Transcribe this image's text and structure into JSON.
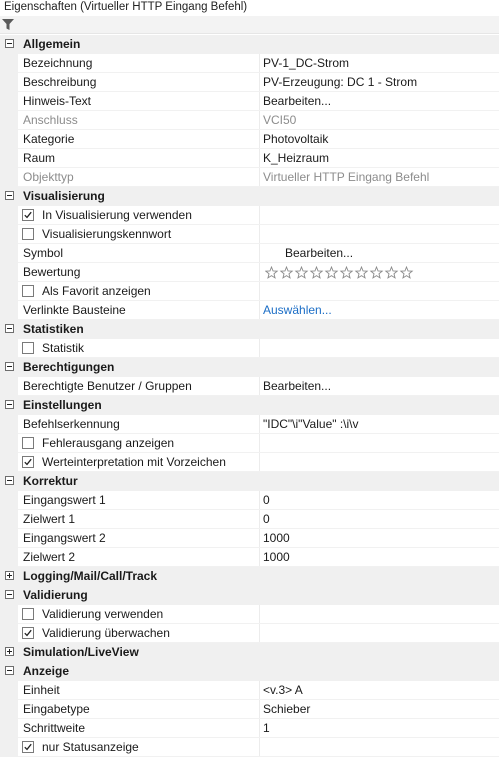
{
  "window": {
    "title": "Eigenschaften (Virtueller HTTP Eingang Befehl)"
  },
  "toolbar": {
    "filter_icon": "filter-icon"
  },
  "colors": {
    "link": "#1c6ec6",
    "disabled": "#8c8c8c",
    "category_bg": "#f0f0f0"
  },
  "sections": {
    "allgemein": {
      "label": "Allgemein",
      "bezeichnung": {
        "label": "Bezeichnung",
        "value": "PV-1_DC-Strom"
      },
      "beschreibung": {
        "label": "Beschreibung",
        "value": "PV-Erzeugung: DC 1 - Strom"
      },
      "hinweis": {
        "label": "Hinweis-Text",
        "value": "Bearbeiten..."
      },
      "anschluss": {
        "label": "Anschluss",
        "value": "VCI50"
      },
      "kategorie": {
        "label": "Kategorie",
        "value": "Photovoltaik"
      },
      "raum": {
        "label": "Raum",
        "value": "K_Heizraum"
      },
      "objekttyp": {
        "label": "Objekttyp",
        "value": "Virtueller HTTP Eingang Befehl"
      }
    },
    "visualisierung": {
      "label": "Visualisierung",
      "in_visu": {
        "label": "In Visualisierung verwenden",
        "checked": true
      },
      "kennwort": {
        "label": "Visualisierungskennwort",
        "checked": false
      },
      "symbol": {
        "label": "Symbol",
        "value": "Bearbeiten..."
      },
      "bewertung": {
        "label": "Bewertung",
        "stars_total": 10,
        "stars_filled": 0
      },
      "favorit": {
        "label": "Als Favorit anzeigen",
        "checked": false
      },
      "bausteine": {
        "label": "Verlinkte Bausteine",
        "value": "Auswählen..."
      }
    },
    "statistiken": {
      "label": "Statistiken",
      "statistik": {
        "label": "Statistik",
        "checked": false
      }
    },
    "berechtigungen": {
      "label": "Berechtigungen",
      "benutzer": {
        "label": "Berechtigte Benutzer / Gruppen",
        "value": "Bearbeiten..."
      }
    },
    "einstellungen": {
      "label": "Einstellungen",
      "befehl": {
        "label": "Befehlserkennung",
        "value": "\"IDC\"\\i\"Value\" :\\i\\v"
      },
      "fehler": {
        "label": "Fehlerausgang anzeigen",
        "checked": false
      },
      "vorzeichen": {
        "label": "Werteinterpretation mit Vorzeichen",
        "checked": true
      }
    },
    "korrektur": {
      "label": "Korrektur",
      "eingang1": {
        "label": "Eingangswert 1",
        "value": "0"
      },
      "ziel1": {
        "label": "Zielwert 1",
        "value": "0"
      },
      "eingang2": {
        "label": "Eingangswert 2",
        "value": "1000"
      },
      "ziel2": {
        "label": "Zielwert 2",
        "value": "1000"
      }
    },
    "logging": {
      "label": "Logging/Mail/Call/Track"
    },
    "validierung": {
      "label": "Validierung",
      "verwenden": {
        "label": "Validierung verwenden",
        "checked": false
      },
      "ueberwachen": {
        "label": "Validierung überwachen",
        "checked": true
      }
    },
    "simulation": {
      "label": "Simulation/LiveView"
    },
    "anzeige": {
      "label": "Anzeige",
      "einheit": {
        "label": "Einheit",
        "value": "<v.3> A"
      },
      "eingabetyp": {
        "label": "Eingabetype",
        "value": "Schieber"
      },
      "schrittweite": {
        "label": "Schrittweite",
        "value": "1"
      },
      "status": {
        "label": "nur Statusanzeige",
        "checked": true
      }
    }
  }
}
